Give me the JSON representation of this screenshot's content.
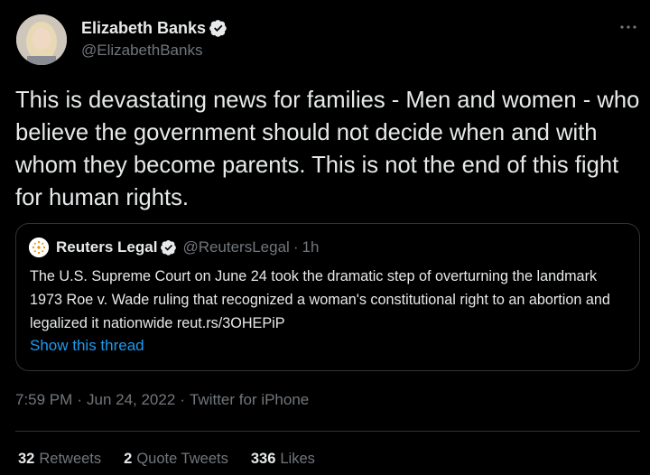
{
  "author": {
    "display_name": "Elizabeth Banks",
    "handle": "@ElizabethBanks",
    "verified_icon": "verified-badge-icon",
    "more_icon": "more-dots-icon"
  },
  "tweet": {
    "text": "This is devastating news for families - Men and women - who believe the government should not decide when and with whom they become parents. This is not the end of this fight for human rights."
  },
  "quoted_tweet": {
    "display_name": "Reuters Legal",
    "handle": "@ReutersLegal",
    "separator": "·",
    "time": "1h",
    "text": "The U.S. Supreme Court on June 24 took the dramatic step of overturning the landmark 1973 Roe v. Wade ruling that recognized a woman's constitutional right to an abortion and legalized it nationwide reut.rs/3OHEPiP",
    "show_thread": "Show this thread"
  },
  "meta": {
    "time": "7:59 PM",
    "sep1": "·",
    "date": "Jun 24, 2022",
    "sep2": "·",
    "source": "Twitter for iPhone"
  },
  "stats": {
    "retweets_count": "32",
    "retweets_label": "Retweets",
    "quotes_count": "2",
    "quotes_label": "Quote Tweets",
    "likes_count": "336",
    "likes_label": "Likes"
  },
  "colors": {
    "background": "#000000",
    "text": "#e7e9ea",
    "secondary": "#71767b",
    "link": "#1d9bf0",
    "border": "#2f3336"
  }
}
